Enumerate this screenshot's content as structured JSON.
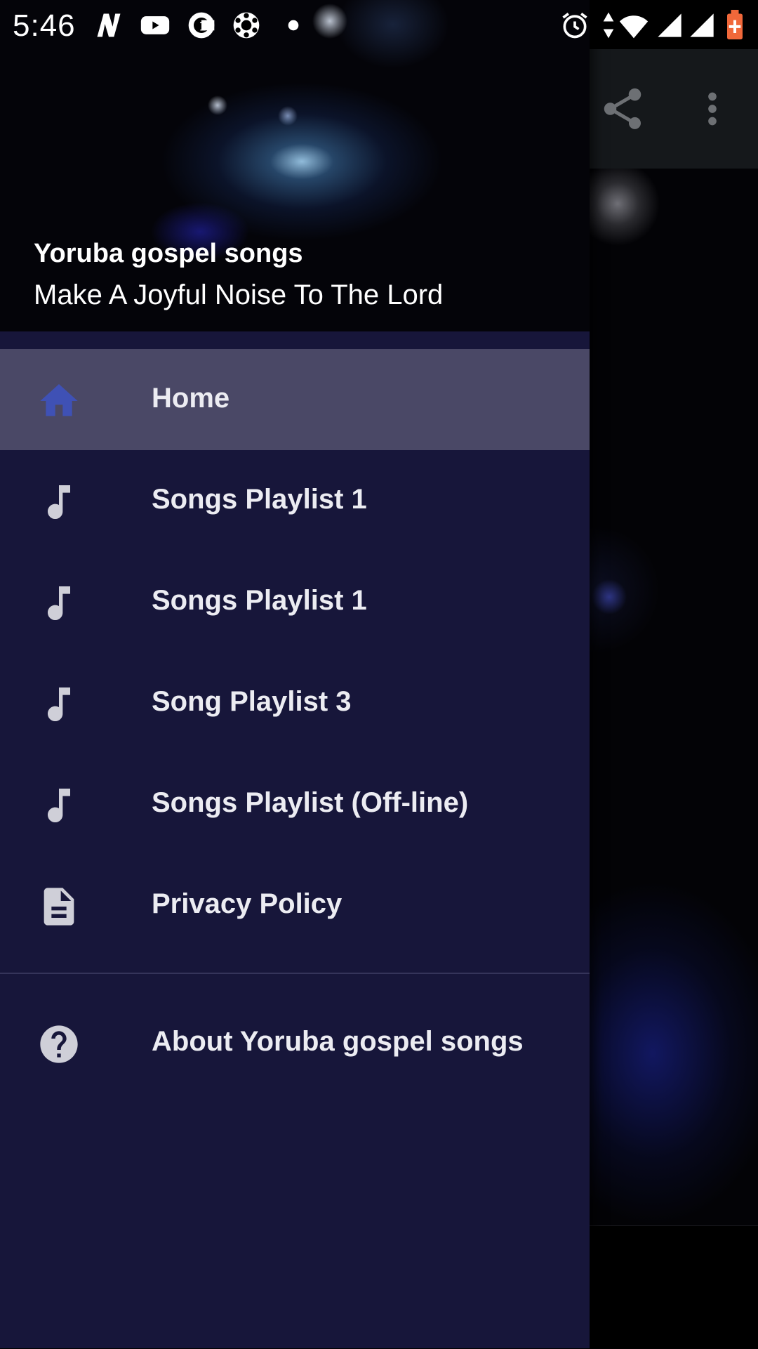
{
  "status_bar": {
    "time": "5:46",
    "left_icons": [
      "n-app-icon",
      "youtube-icon",
      "c-app-icon",
      "settings-cog-icon",
      "dot-icon"
    ],
    "right_icons": [
      "alarm-icon",
      "data-arrows-icon",
      "wifi-icon",
      "signal-icon",
      "signal-icon",
      "battery-charging-icon"
    ]
  },
  "toolbar": {
    "icons": [
      "share-icon",
      "more-vert-icon"
    ]
  },
  "drawer": {
    "header": {
      "title": "Yoruba gospel songs",
      "subtitle": "Make A Joyful Noise To The Lord"
    },
    "items": [
      {
        "label": "Home",
        "icon": "home-icon",
        "active": true
      },
      {
        "label": "Songs Playlist 1",
        "icon": "music-note-icon"
      },
      {
        "label": "Songs Playlist 1",
        "icon": "music-note-icon"
      },
      {
        "label": "Song Playlist 3",
        "icon": "music-note-icon"
      },
      {
        "label": "Songs Playlist (Off-line)",
        "icon": "music-note-icon"
      },
      {
        "label": "Privacy Policy",
        "icon": "document-icon"
      }
    ],
    "about": {
      "label": "About Yoruba gospel songs",
      "icon": "help-circle-icon"
    }
  },
  "colors": {
    "drawer_bg": "#17163a",
    "active_item_bg": "#4a4866",
    "active_icon": "#3f51b5",
    "icon_default": "#cfcfd8"
  }
}
